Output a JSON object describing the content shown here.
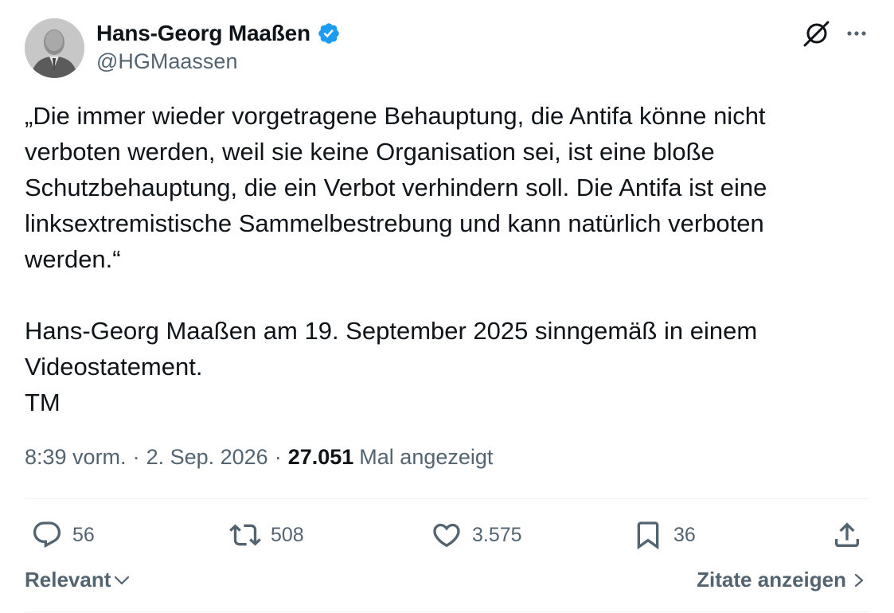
{
  "author": {
    "display_name": "Hans-Georg Maaßen",
    "handle": "@HGMaassen"
  },
  "tweet": {
    "paragraphs": [
      "„Die immer wieder vorgetragene Behauptung, die Antifa könne nicht verboten werden, weil sie keine Organisation sei, ist eine bloße Schutzbehauptung, die ein Verbot verhindern soll. Die Antifa ist eine linksextremistische Sammelbestrebung und kann natürlich verboten werden.“",
      "Hans-Georg Maaßen am 19. September 2025 sinngemäß in einem Videostatement.",
      "TM"
    ]
  },
  "meta": {
    "time": "8:39 vorm.",
    "separator": "·",
    "date": "2. Sep. 2026",
    "views_count": "27.051",
    "views_label": "Mal angezeigt"
  },
  "actions": {
    "replies": "56",
    "reposts": "508",
    "likes": "3.575",
    "bookmarks": "36"
  },
  "footer": {
    "sort_label": "Relevant",
    "quotes_label": "Zitate anzeigen"
  },
  "icons": {
    "verified": "verified-badge-icon",
    "grok": "grok-icon",
    "more": "more-icon",
    "reply": "reply-icon",
    "repost": "repost-icon",
    "like": "like-icon",
    "bookmark": "bookmark-icon",
    "share": "share-icon",
    "chevron_down": "chevron-down-icon",
    "chevron_right": "chevron-right-icon"
  },
  "colors": {
    "text_primary": "#0f1419",
    "text_secondary": "#536471",
    "verified_blue": "#1d9bf0",
    "divider": "#eff3f4"
  }
}
